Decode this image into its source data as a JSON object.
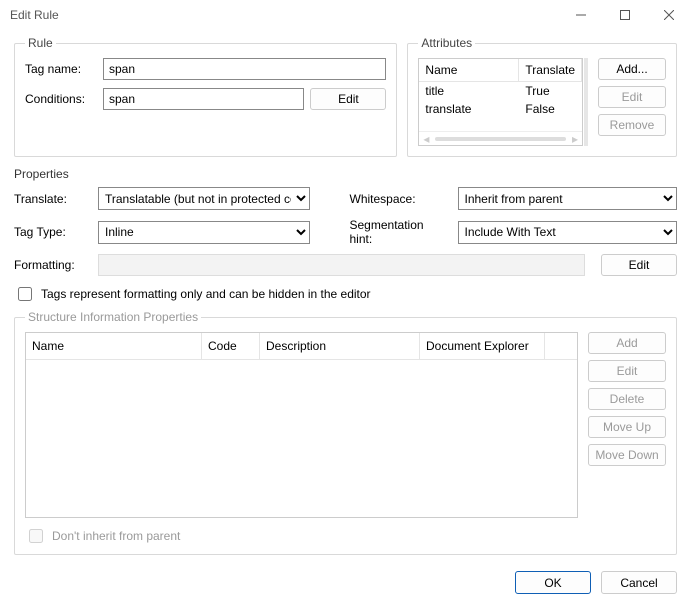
{
  "window": {
    "title": "Edit Rule"
  },
  "rule": {
    "legend": "Rule",
    "tagname_label": "Tag name:",
    "tagname_value": "span",
    "conditions_label": "Conditions:",
    "conditions_value": "span",
    "edit_btn": "Edit"
  },
  "attributes": {
    "legend": "Attributes",
    "col_name": "Name",
    "col_translate": "Translate",
    "rows": [
      {
        "name": "title",
        "translate": "True"
      },
      {
        "name": "translate",
        "translate": "False"
      }
    ],
    "add_btn": "Add...",
    "edit_btn": "Edit",
    "remove_btn": "Remove"
  },
  "properties": {
    "legend": "Properties",
    "translate_label": "Translate:",
    "translate_value": "Translatable (but not in protected content)",
    "whitespace_label": "Whitespace:",
    "whitespace_value": "Inherit from parent",
    "tagtype_label": "Tag Type:",
    "tagtype_value": "Inline",
    "seghint_label": "Segmentation hint:",
    "seghint_value": "Include With Text",
    "formatting_label": "Formatting:",
    "formatting_value": "",
    "formatting_edit": "Edit",
    "checkbox_label": "Tags represent formatting only and can be hidden in the editor"
  },
  "structure": {
    "legend": "Structure Information Properties",
    "col_name": "Name",
    "col_code": "Code",
    "col_desc": "Description",
    "col_doc": "Document Explorer",
    "add": "Add",
    "edit": "Edit",
    "delete": "Delete",
    "moveup": "Move Up",
    "movedown": "Move Down",
    "inherit_cb": "Don't inherit from parent"
  },
  "footer": {
    "ok": "OK",
    "cancel": "Cancel"
  }
}
